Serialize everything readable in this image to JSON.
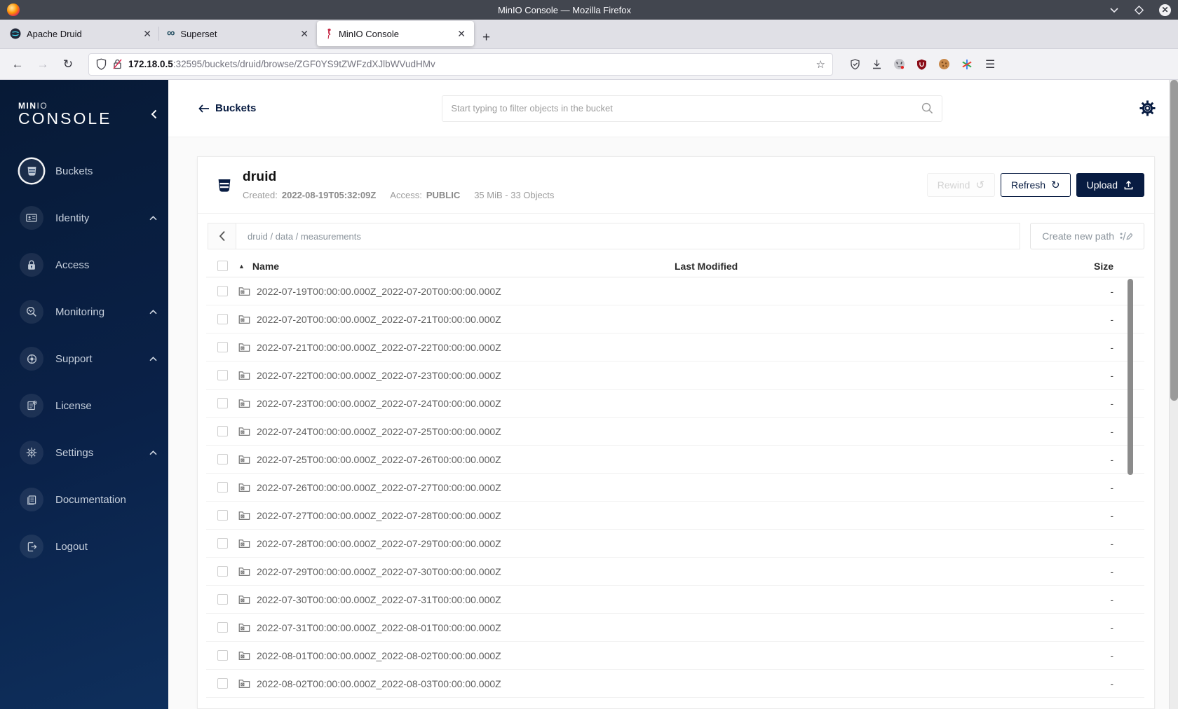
{
  "window": {
    "title": "MinIO Console — Mozilla Firefox"
  },
  "browser": {
    "tabs": [
      {
        "label": "Apache Druid",
        "favicon": "druid-icon",
        "active": false
      },
      {
        "label": "Superset",
        "favicon": "superset-infinity-icon",
        "active": false
      },
      {
        "label": "MinIO Console",
        "favicon": "minio-flamingo-icon",
        "active": true
      }
    ],
    "new_tab_label": "+",
    "close_tab_label": "✕",
    "url_host": "172.18.0.5",
    "url_rest": ":32595/buckets/druid/browse/ZGF0YS9tZWFzdXJlbWVudHMv"
  },
  "sidebar": {
    "logo_min": "MIN",
    "logo_io": "IO",
    "logo_console": "CONSOLE",
    "items": [
      {
        "label": "Buckets",
        "active": true,
        "expandable": false
      },
      {
        "label": "Identity",
        "active": false,
        "expandable": true
      },
      {
        "label": "Access",
        "active": false,
        "expandable": false
      },
      {
        "label": "Monitoring",
        "active": false,
        "expandable": true
      },
      {
        "label": "Support",
        "active": false,
        "expandable": true
      },
      {
        "label": "License",
        "active": false,
        "expandable": false
      },
      {
        "label": "Settings",
        "active": false,
        "expandable": true
      },
      {
        "label": "Documentation",
        "active": false,
        "expandable": false
      }
    ],
    "logout_label": "Logout"
  },
  "header": {
    "back_label": "Buckets",
    "search_placeholder": "Start typing to filter objects in the bucket"
  },
  "bucket": {
    "name": "druid",
    "created_label": "Created:",
    "created_value": "2022-08-19T05:32:09Z",
    "access_label": "Access:",
    "access_value": "PUBLIC",
    "objects_summary": "35 MiB - 33 Objects",
    "rewind_label": "Rewind",
    "refresh_label": "Refresh",
    "upload_label": "Upload"
  },
  "browse": {
    "breadcrumb": "druid / data / measurements",
    "create_path_label": "Create new path",
    "headers": {
      "name": "Name",
      "last_modified": "Last Modified",
      "size": "Size"
    },
    "rows": [
      {
        "name": "2022-07-19T00:00:00.000Z_2022-07-20T00:00:00.000Z",
        "last_modified": "",
        "size": "-"
      },
      {
        "name": "2022-07-20T00:00:00.000Z_2022-07-21T00:00:00.000Z",
        "last_modified": "",
        "size": "-"
      },
      {
        "name": "2022-07-21T00:00:00.000Z_2022-07-22T00:00:00.000Z",
        "last_modified": "",
        "size": "-"
      },
      {
        "name": "2022-07-22T00:00:00.000Z_2022-07-23T00:00:00.000Z",
        "last_modified": "",
        "size": "-"
      },
      {
        "name": "2022-07-23T00:00:00.000Z_2022-07-24T00:00:00.000Z",
        "last_modified": "",
        "size": "-"
      },
      {
        "name": "2022-07-24T00:00:00.000Z_2022-07-25T00:00:00.000Z",
        "last_modified": "",
        "size": "-"
      },
      {
        "name": "2022-07-25T00:00:00.000Z_2022-07-26T00:00:00.000Z",
        "last_modified": "",
        "size": "-"
      },
      {
        "name": "2022-07-26T00:00:00.000Z_2022-07-27T00:00:00.000Z",
        "last_modified": "",
        "size": "-"
      },
      {
        "name": "2022-07-27T00:00:00.000Z_2022-07-28T00:00:00.000Z",
        "last_modified": "",
        "size": "-"
      },
      {
        "name": "2022-07-28T00:00:00.000Z_2022-07-29T00:00:00.000Z",
        "last_modified": "",
        "size": "-"
      },
      {
        "name": "2022-07-29T00:00:00.000Z_2022-07-30T00:00:00.000Z",
        "last_modified": "",
        "size": "-"
      },
      {
        "name": "2022-07-30T00:00:00.000Z_2022-07-31T00:00:00.000Z",
        "last_modified": "",
        "size": "-"
      },
      {
        "name": "2022-07-31T00:00:00.000Z_2022-08-01T00:00:00.000Z",
        "last_modified": "",
        "size": "-"
      },
      {
        "name": "2022-08-01T00:00:00.000Z_2022-08-02T00:00:00.000Z",
        "last_modified": "",
        "size": "-"
      },
      {
        "name": "2022-08-02T00:00:00.000Z_2022-08-03T00:00:00.000Z",
        "last_modified": "",
        "size": "-"
      }
    ]
  },
  "colors": {
    "navy": "#081C42",
    "flamingo": "#C72C48",
    "sidebar_top": "#071a36",
    "sidebar_bottom": "#0e2f5c",
    "titlebar": "#42464f"
  }
}
